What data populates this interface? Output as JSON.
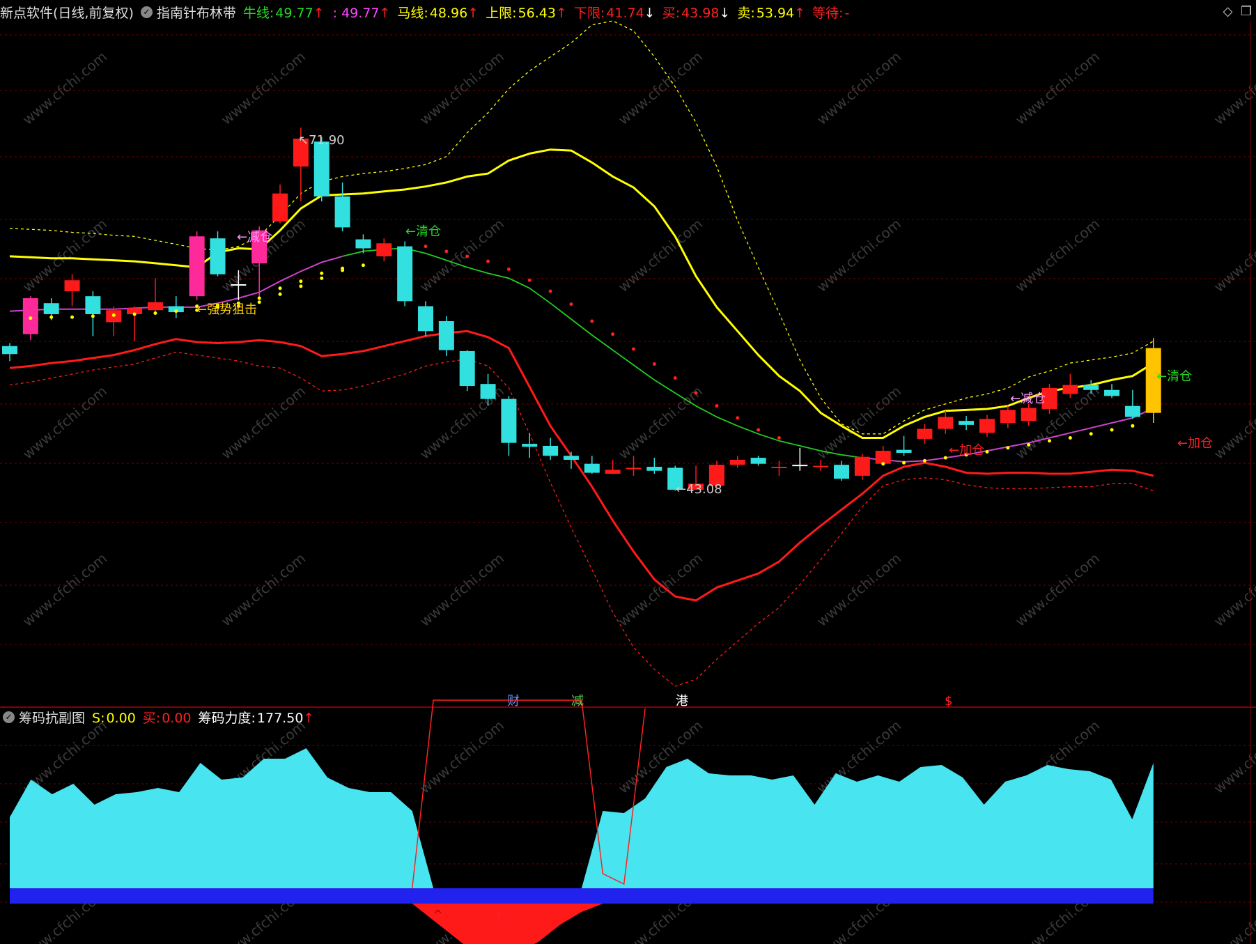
{
  "header": {
    "app": "新点软件(日线,前复权)",
    "indicator": "指南针布林带",
    "items": [
      {
        "label": "牛线:",
        "value": "49.77",
        "arrow": "↑",
        "color": "#22dd22",
        "value_color": "#22dd22"
      },
      {
        "label": "",
        "value": ": 49.77",
        "arrow": "↑",
        "color": "#ff44ff",
        "value_color": "#ff44ff"
      },
      {
        "label": "马线:",
        "value": "48.96",
        "arrow": "↑",
        "color": "#ffff00",
        "value_color": "#ffff00"
      },
      {
        "label": "上限:",
        "value": "56.43",
        "arrow": "↑",
        "color": "#ffff00",
        "value_color": "#ffff00"
      },
      {
        "label": "下限:",
        "value": "41.74",
        "arrow": "↓",
        "color": "#ff2020",
        "value_color": "#ff2020"
      },
      {
        "label": "买:",
        "value": "43.98",
        "arrow": "↓",
        "color": "#ff2020",
        "value_color": "#ff2020"
      },
      {
        "label": "卖:",
        "value": "53.94",
        "arrow": "↑",
        "color": "#ffff00",
        "value_color": "#ffff00"
      },
      {
        "label": "等待:",
        "value": "-",
        "arrow": "",
        "color": "#ff2020",
        "value_color": "#ff2020"
      }
    ]
  },
  "sub_header": {
    "title": "筹码抗副图",
    "items": [
      {
        "label": "S:",
        "value": "0.00",
        "arrow": "",
        "color": "#ffff00",
        "value_color": "#ffff00"
      },
      {
        "label": "买:",
        "value": "0.00",
        "arrow": "",
        "color": "#ff2020",
        "value_color": "#ff2020"
      },
      {
        "label": "筹码力度:",
        "value": "177.50",
        "arrow": "↑",
        "color": "#ffffff",
        "value_color": "#ffffff"
      }
    ]
  },
  "annotations": {
    "high": "71.90",
    "low": "43.08",
    "strong_block": "←强势狙击",
    "reduce_1": "←减仓",
    "clear_1": "←清仓",
    "add_1": "←加仓",
    "reduce_2": "←减仓",
    "clear_2": "←清仓",
    "add_2": "←加仓"
  },
  "markers": [
    {
      "text": "财",
      "color": "#5599ff"
    },
    {
      "text": "减",
      "color": "#55dd55"
    },
    {
      "text": "港",
      "color": "#ffffff"
    },
    {
      "text": "$",
      "color": "#ff2020"
    }
  ],
  "watermark": "www.cfchi.com",
  "colors": {
    "up": "#ff1a1a",
    "down": "#33e0e0",
    "upper": "#ffff00",
    "lower": "#ff1a1a",
    "mid": "#cc44cc",
    "ma": "#22cc22",
    "chips": "#48e4f0",
    "base": "#2222ee"
  },
  "candles": [
    {
      "o": 50.0,
      "c": 49.2,
      "h": 50.3,
      "l": 48.5
    },
    {
      "o": 51.2,
      "c": 54.8,
      "h": 55.0,
      "l": 50.6
    },
    {
      "o": 54.3,
      "c": 53.2,
      "h": 54.8,
      "l": 52.6
    },
    {
      "o": 55.5,
      "c": 56.6,
      "h": 57.2,
      "l": 54.0
    },
    {
      "o": 55.0,
      "c": 53.2,
      "h": 55.5,
      "l": 51.0
    },
    {
      "o": 52.4,
      "c": 53.6,
      "h": 54.0,
      "l": 51.0
    },
    {
      "o": 53.2,
      "c": 53.8,
      "h": 54.0,
      "l": 50.5
    },
    {
      "o": 53.6,
      "c": 54.4,
      "h": 56.8,
      "l": 53.2
    },
    {
      "o": 54.0,
      "c": 53.4,
      "h": 55.0,
      "l": 52.8
    },
    {
      "o": 55.0,
      "c": 61.0,
      "h": 61.5,
      "l": 54.6
    },
    {
      "o": 60.8,
      "c": 57.2,
      "h": 61.5,
      "l": 57.0
    },
    {
      "o": 56.2,
      "c": 56.2,
      "h": 57.6,
      "l": 54.6
    },
    {
      "o": 58.3,
      "c": 61.6,
      "h": 62.0,
      "l": 54.8
    },
    {
      "o": 62.5,
      "c": 65.3,
      "h": 66.2,
      "l": 62.3
    },
    {
      "o": 68.0,
      "c": 70.8,
      "h": 71.9,
      "l": 64.5
    },
    {
      "o": 70.5,
      "c": 65.0,
      "h": 71.0,
      "l": 64.5
    },
    {
      "o": 65.0,
      "c": 61.9,
      "h": 66.4,
      "l": 61.5
    },
    {
      "o": 60.7,
      "c": 59.8,
      "h": 61.2,
      "l": 59.3
    },
    {
      "o": 59.0,
      "c": 60.3,
      "h": 60.8,
      "l": 58.5
    },
    {
      "o": 60.0,
      "c": 54.5,
      "h": 60.5,
      "l": 54.0
    },
    {
      "o": 54.0,
      "c": 51.5,
      "h": 54.5,
      "l": 51.0
    },
    {
      "o": 52.5,
      "c": 49.6,
      "h": 53.0,
      "l": 49.0
    },
    {
      "o": 49.5,
      "c": 46.0,
      "h": 49.6,
      "l": 45.5
    },
    {
      "o": 46.2,
      "c": 44.7,
      "h": 47.2,
      "l": 44.0
    },
    {
      "o": 44.7,
      "c": 40.3,
      "h": 45.0,
      "l": 39.0
    },
    {
      "o": 40.2,
      "c": 39.9,
      "h": 41.3,
      "l": 38.8
    },
    {
      "o": 40.0,
      "c": 39.0,
      "h": 40.8,
      "l": 38.6
    },
    {
      "o": 39.0,
      "c": 38.6,
      "h": 39.4,
      "l": 37.7
    },
    {
      "o": 38.2,
      "c": 37.3,
      "h": 39.0,
      "l": 37.2
    },
    {
      "o": 37.2,
      "c": 37.6,
      "h": 38.6,
      "l": 37.2
    },
    {
      "o": 37.8,
      "c": 37.8,
      "h": 39.0,
      "l": 37.0
    },
    {
      "o": 37.9,
      "c": 37.5,
      "h": 38.8,
      "l": 37.2
    },
    {
      "o": 37.8,
      "c": 35.6,
      "h": 38.0,
      "l": 35.5
    },
    {
      "o": 35.6,
      "c": 36.2,
      "h": 38.0,
      "l": 35.6
    },
    {
      "o": 36.0,
      "c": 38.1,
      "h": 38.5,
      "l": 35.8
    },
    {
      "o": 38.1,
      "c": 38.6,
      "h": 39.0,
      "l": 37.8
    },
    {
      "o": 38.8,
      "c": 38.2,
      "h": 39.0,
      "l": 38.0
    },
    {
      "o": 37.9,
      "c": 37.9,
      "h": 38.5,
      "l": 37.0
    },
    {
      "o": 38.0,
      "c": 38.1,
      "h": 39.8,
      "l": 37.5
    },
    {
      "o": 38.0,
      "c": 38.0,
      "h": 38.6,
      "l": 37.5
    },
    {
      "o": 38.1,
      "c": 36.7,
      "h": 38.5,
      "l": 36.5
    },
    {
      "o": 37.0,
      "c": 38.9,
      "h": 39.2,
      "l": 36.6
    },
    {
      "o": 38.2,
      "c": 39.5,
      "h": 40.0,
      "l": 38.0
    },
    {
      "o": 39.6,
      "c": 39.3,
      "h": 41.0,
      "l": 39.0
    },
    {
      "o": 40.7,
      "c": 41.7,
      "h": 42.2,
      "l": 40.2
    },
    {
      "o": 41.7,
      "c": 42.9,
      "h": 43.5,
      "l": 41.2
    },
    {
      "o": 42.5,
      "c": 42.1,
      "h": 43.0,
      "l": 41.6
    },
    {
      "o": 41.3,
      "c": 42.7,
      "h": 43.1,
      "l": 40.9
    },
    {
      "o": 42.3,
      "c": 43.6,
      "h": 44.0,
      "l": 41.8
    },
    {
      "o": 42.5,
      "c": 43.8,
      "h": 44.2,
      "l": 42.0
    },
    {
      "o": 43.7,
      "c": 45.8,
      "h": 46.2,
      "l": 43.2
    },
    {
      "o": 45.2,
      "c": 46.1,
      "h": 47.2,
      "l": 44.8
    },
    {
      "o": 46.1,
      "c": 45.6,
      "h": 46.6,
      "l": 45.2
    },
    {
      "o": 45.6,
      "c": 45.0,
      "h": 46.2,
      "l": 44.8
    },
    {
      "o": 44.0,
      "c": 42.9,
      "h": 45.6,
      "l": 42.7
    },
    {
      "o": 43.3,
      "c": 49.8,
      "h": 50.8,
      "l": 42.3
    }
  ],
  "special_candles": {
    "white": [
      11,
      38
    ],
    "pink": [
      1,
      9,
      12
    ],
    "gold": [
      55
    ]
  },
  "bands": {
    "upper": [
      59.0,
      58.9,
      58.8,
      58.8,
      58.7,
      58.6,
      58.5,
      58.3,
      58.1,
      57.9,
      59.4,
      59.8,
      59.7,
      61.6,
      63.8,
      65.1,
      65.2,
      65.3,
      65.5,
      65.7,
      66.0,
      66.4,
      67.0,
      67.3,
      68.6,
      69.3,
      69.7,
      69.6,
      68.4,
      67.0,
      65.9,
      64.0,
      61.0,
      57.0,
      53.9,
      51.5,
      49.1,
      47.0,
      45.5,
      43.3,
      42.0,
      40.8,
      40.8,
      42.0,
      42.9,
      43.5,
      43.6,
      43.7,
      44.0,
      44.8,
      45.5,
      45.8,
      46.1,
      46.6,
      47.0,
      48.3
    ],
    "lower": [
      47.8,
      48.0,
      48.3,
      48.5,
      48.8,
      49.1,
      49.6,
      50.2,
      50.7,
      50.4,
      50.3,
      50.4,
      50.6,
      50.4,
      50.0,
      49.0,
      49.2,
      49.5,
      50.0,
      50.5,
      51.0,
      51.3,
      51.5,
      50.9,
      49.8,
      45.9,
      42.0,
      39.0,
      35.9,
      32.5,
      29.4,
      26.6,
      24.9,
      24.5,
      25.8,
      26.5,
      27.2,
      28.4,
      30.3,
      32.0,
      33.6,
      35.2,
      37.0,
      37.9,
      38.3,
      37.9,
      37.3,
      37.2,
      37.3,
      37.3,
      37.2,
      37.2,
      37.4,
      37.6,
      37.5,
      37.0
    ],
    "upper2": [
      61.8,
      61.7,
      61.6,
      61.4,
      61.3,
      61.1,
      61.0,
      60.6,
      60.2,
      59.8,
      59.6,
      60.0,
      61.0,
      63.1,
      65.3,
      66.5,
      67.0,
      67.3,
      67.5,
      67.8,
      68.2,
      69.0,
      71.4,
      73.4,
      75.8,
      77.6,
      79.0,
      80.4,
      82.2,
      82.6,
      81.6,
      79.0,
      76.0,
      72.4,
      68.0,
      62.6,
      57.9,
      53.3,
      48.6,
      44.8,
      42.2,
      41.2,
      41.2,
      42.5,
      43.6,
      44.2,
      44.8,
      45.2,
      45.8,
      46.9,
      47.5,
      48.3,
      48.6,
      48.9,
      49.3,
      50.5
    ],
    "lower2": [
      46.1,
      46.4,
      46.8,
      47.2,
      47.6,
      47.9,
      48.2,
      48.8,
      49.4,
      49.1,
      48.8,
      48.5,
      48.0,
      47.8,
      46.8,
      45.5,
      45.6,
      46.0,
      46.6,
      47.2,
      48.0,
      48.4,
      48.7,
      48.0,
      45.8,
      41.2,
      36.3,
      31.8,
      27.6,
      23.3,
      19.8,
      17.6,
      15.9,
      16.6,
      18.6,
      20.4,
      22.2,
      23.8,
      26.1,
      28.6,
      31.2,
      33.9,
      36.0,
      36.6,
      36.8,
      36.6,
      36.1,
      35.8,
      35.7,
      35.7,
      35.8,
      35.9,
      35.9,
      36.2,
      36.2,
      35.5
    ],
    "mid": [
      53.5,
      53.6,
      53.7,
      53.7,
      53.7,
      53.7,
      53.8,
      53.9,
      53.9,
      53.9,
      54.3,
      54.8,
      55.4,
      56.5,
      57.5,
      58.4,
      59.0,
      59.5,
      59.7,
      59.8,
      59.3,
      58.6,
      57.9,
      57.3,
      56.8,
      55.8,
      54.3,
      52.7,
      51.1,
      49.6,
      48.1,
      46.6,
      45.3,
      44.0,
      42.9,
      42.0,
      41.2,
      40.5,
      40.0,
      39.5,
      39.1,
      38.8,
      38.6,
      38.4,
      38.5,
      38.8,
      39.1,
      39.5,
      39.9,
      40.3,
      40.8,
      41.3,
      41.8,
      42.3,
      42.8,
      43.8
    ],
    "mid_dots_start": 38,
    "buy_dots": [
      [
        9,
        54.0
      ],
      [
        10,
        54.1
      ],
      [
        11,
        54.3
      ],
      [
        12,
        54.8
      ],
      [
        13,
        55.8
      ],
      [
        14,
        56.5
      ],
      [
        15,
        57.3
      ],
      [
        16,
        57.8
      ]
    ],
    "sell_dots": [
      [
        20,
        60.0
      ],
      [
        21,
        59.5
      ],
      [
        22,
        59.0
      ],
      [
        23,
        58.5
      ],
      [
        24,
        57.7
      ],
      [
        25,
        56.6
      ],
      [
        26,
        55.5
      ],
      [
        27,
        54.2
      ],
      [
        28,
        52.5
      ],
      [
        29,
        51.2
      ],
      [
        30,
        49.7
      ],
      [
        31,
        48.2
      ],
      [
        32,
        46.8
      ],
      [
        33,
        45.3
      ],
      [
        34,
        44.0
      ],
      [
        35,
        42.8
      ],
      [
        36,
        41.6
      ],
      [
        37,
        40.8
      ]
    ],
    "yellow_dots": [
      [
        1,
        52.8
      ],
      [
        2,
        52.9
      ],
      [
        3,
        52.9
      ],
      [
        4,
        53.0
      ],
      [
        5,
        53.1
      ],
      [
        6,
        53.2
      ],
      [
        7,
        53.3
      ],
      [
        8,
        53.5
      ],
      [
        9,
        53.6
      ],
      [
        10,
        53.9
      ],
      [
        11,
        54.0
      ],
      [
        12,
        54.4
      ],
      [
        13,
        55.2
      ],
      [
        14,
        56.0
      ],
      [
        15,
        56.8
      ],
      [
        16,
        57.6
      ],
      [
        17,
        58.1
      ],
      [
        42,
        38.2
      ],
      [
        43,
        38.3
      ],
      [
        44,
        38.5
      ],
      [
        45,
        38.8
      ],
      [
        46,
        39.1
      ],
      [
        47,
        39.4
      ],
      [
        48,
        39.8
      ],
      [
        49,
        40.1
      ],
      [
        50,
        40.5
      ],
      [
        51,
        40.8
      ],
      [
        52,
        41.2
      ],
      [
        53,
        41.6
      ],
      [
        54,
        42.0
      ]
    ]
  },
  "chips": [
    34,
    52,
    45,
    50,
    40,
    45,
    46,
    48,
    46,
    60,
    52,
    53,
    62,
    62,
    67,
    53,
    48,
    46,
    46,
    37,
    0,
    0,
    0,
    0,
    0,
    0,
    0,
    0,
    37,
    36,
    43,
    58,
    62,
    55,
    54,
    54,
    52,
    54,
    40,
    55,
    51,
    54,
    51,
    58,
    59,
    53,
    40,
    51,
    54,
    59,
    57,
    56,
    52,
    33,
    60
  ],
  "chips_neg": [
    0,
    0,
    0,
    0,
    0,
    0,
    0,
    0,
    0,
    0,
    0,
    0,
    0,
    0,
    0,
    0,
    0,
    0,
    0,
    0,
    -8,
    -16,
    -24,
    -28,
    -24,
    -18,
    -10,
    -4,
    0,
    0,
    0,
    0,
    0,
    0,
    0,
    0,
    0,
    0,
    0,
    0,
    0,
    0,
    0,
    0,
    0,
    0,
    0,
    0,
    0,
    0,
    0,
    0,
    0,
    0,
    0
  ],
  "chips_line": [
    0,
    0,
    0,
    0,
    0,
    0,
    0,
    0,
    0,
    0,
    0,
    0,
    0,
    0,
    0,
    0,
    0,
    0,
    0,
    0,
    90,
    90,
    90,
    90,
    90,
    90,
    90,
    90,
    7,
    2,
    86,
    2,
    0,
    0,
    0,
    0,
    0,
    0,
    0,
    0,
    0,
    0,
    0,
    0,
    0,
    0,
    0,
    0,
    0,
    0,
    0,
    0,
    0,
    0,
    0
  ]
}
